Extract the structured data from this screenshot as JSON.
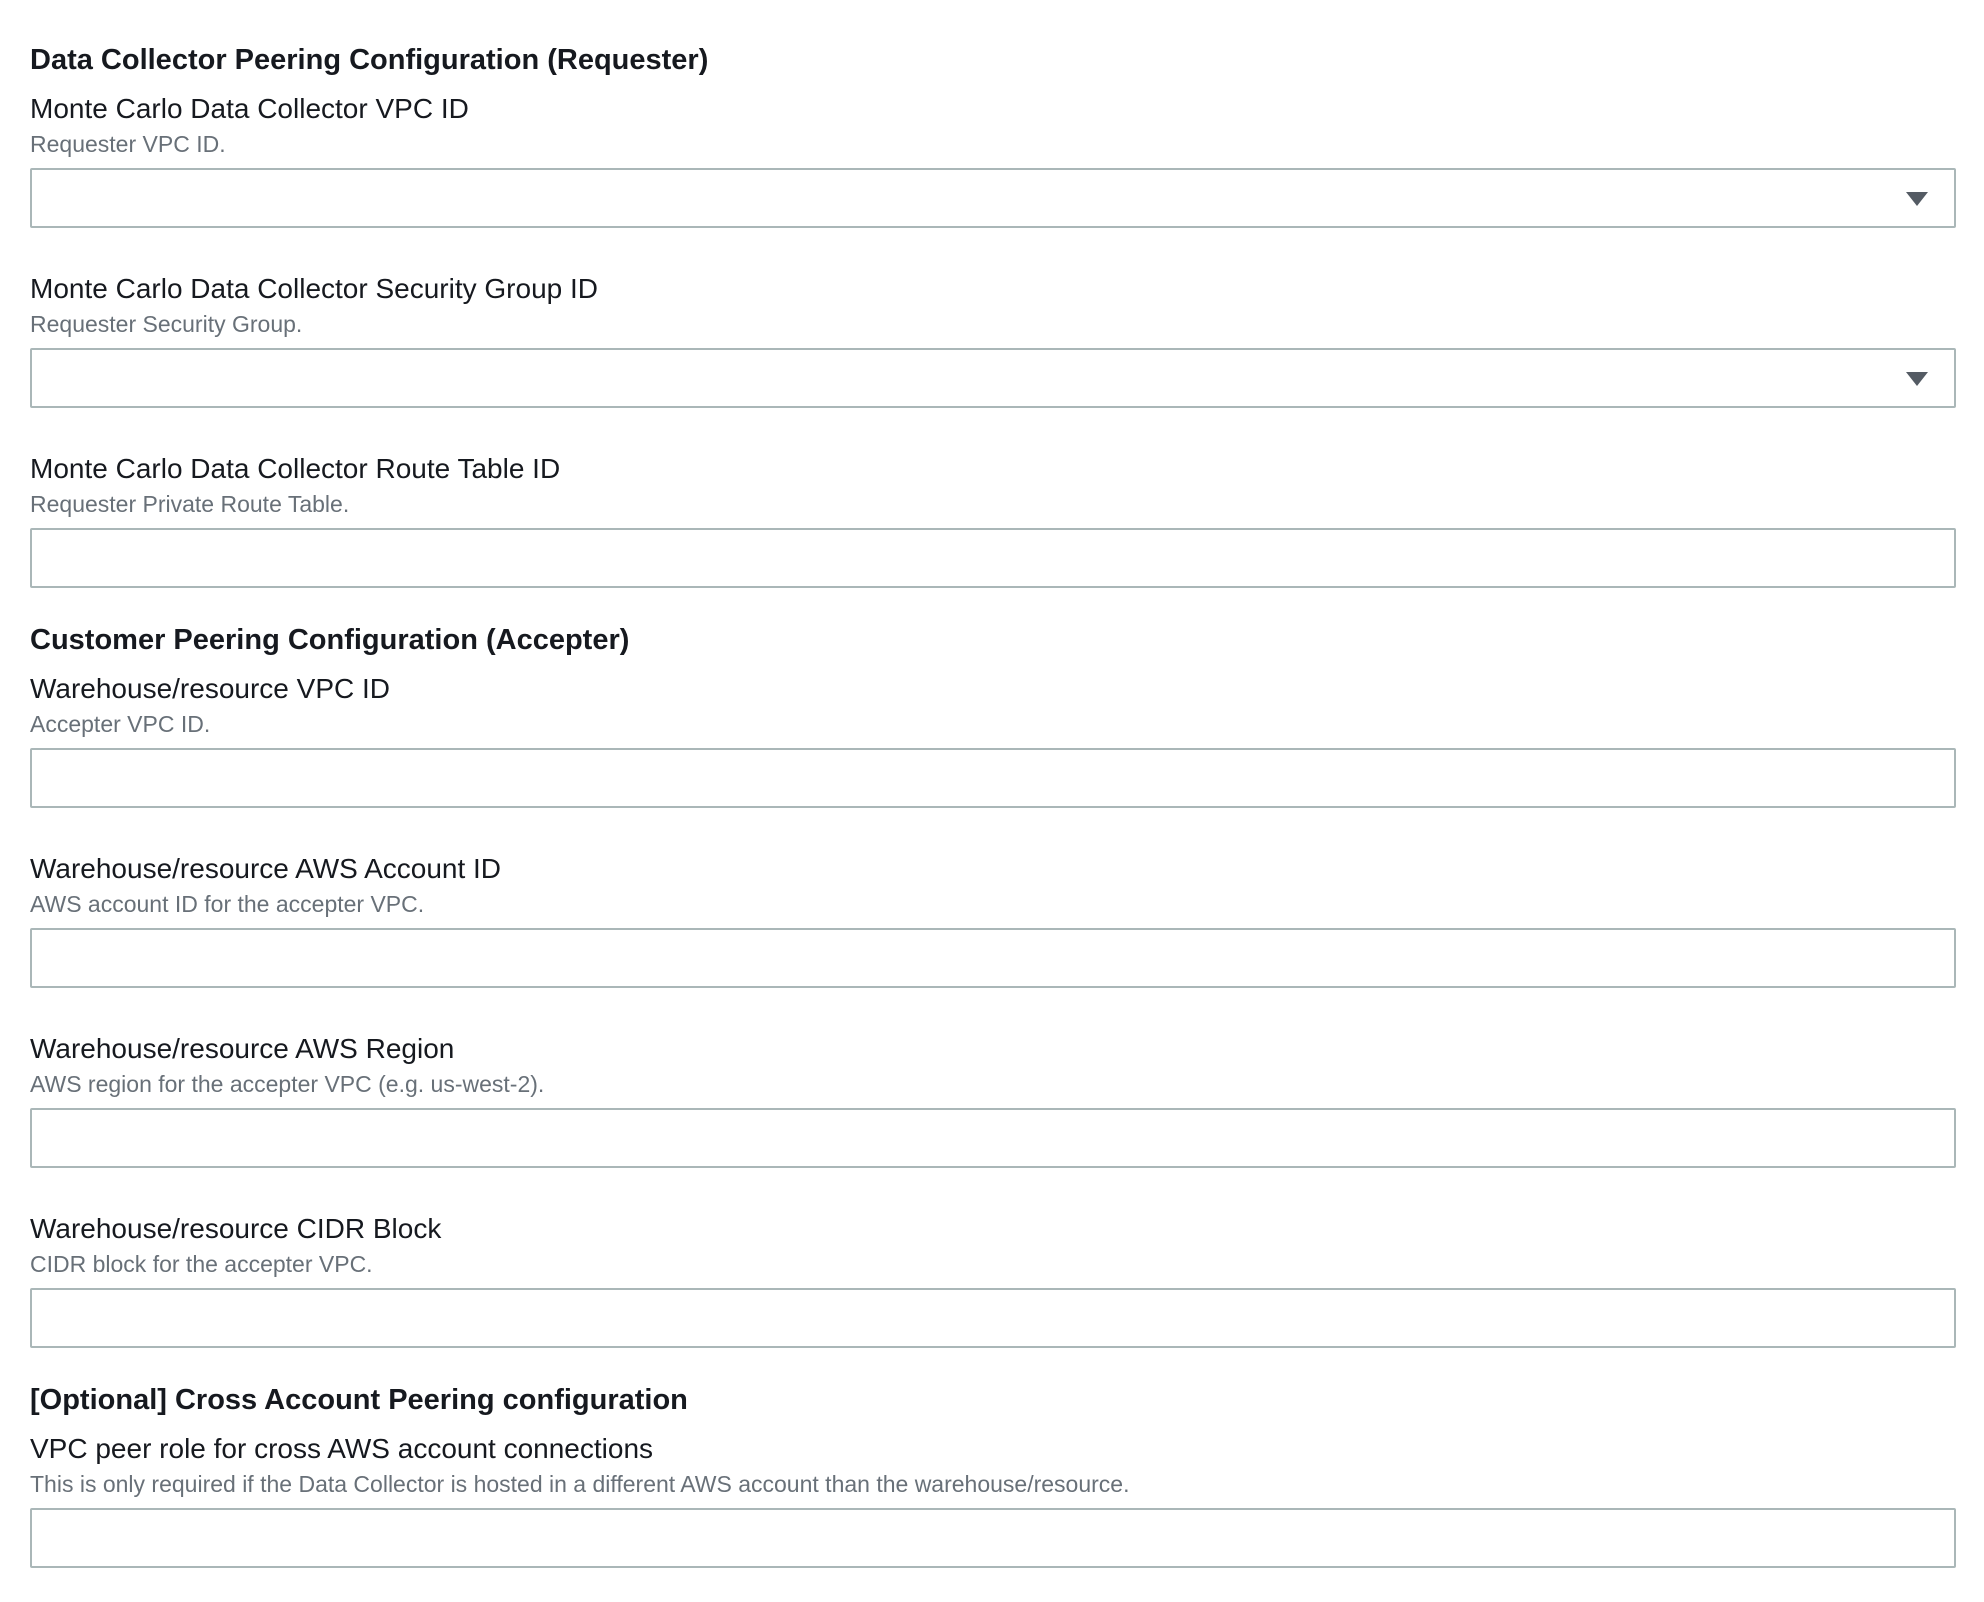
{
  "sections": [
    {
      "title": "Data Collector Peering Configuration (Requester)",
      "fields": [
        {
          "label": "Monte Carlo Data Collector VPC ID",
          "description": "Requester VPC ID.",
          "type": "select",
          "value": ""
        },
        {
          "label": "Monte Carlo Data Collector Security Group ID",
          "description": "Requester Security Group.",
          "type": "select",
          "value": ""
        },
        {
          "label": "Monte Carlo Data Collector Route Table ID",
          "description": "Requester Private Route Table.",
          "type": "text",
          "value": ""
        }
      ]
    },
    {
      "title": "Customer Peering Configuration (Accepter)",
      "fields": [
        {
          "label": "Warehouse/resource VPC ID",
          "description": "Accepter VPC ID.",
          "type": "text",
          "value": ""
        },
        {
          "label": "Warehouse/resource AWS Account ID",
          "description": "AWS account ID for the accepter VPC.",
          "type": "text",
          "value": ""
        },
        {
          "label": "Warehouse/resource AWS Region",
          "description": "AWS region for the accepter VPC (e.g. us-west-2).",
          "type": "text",
          "value": ""
        },
        {
          "label": "Warehouse/resource CIDR Block",
          "description": "CIDR block for the accepter VPC.",
          "type": "text",
          "value": ""
        }
      ]
    },
    {
      "title": "[Optional] Cross Account Peering configuration",
      "fields": [
        {
          "label": "VPC peer role for cross AWS account connections",
          "description": "This is only required if the Data Collector is hosted in a different AWS account than the warehouse/resource.",
          "type": "text",
          "value": ""
        }
      ]
    }
  ],
  "icons": {
    "dropdown": "caret-down-icon"
  },
  "colors": {
    "label": "#16191f",
    "description": "#687078",
    "border": "#aab7b8",
    "caret": "#545b64"
  }
}
